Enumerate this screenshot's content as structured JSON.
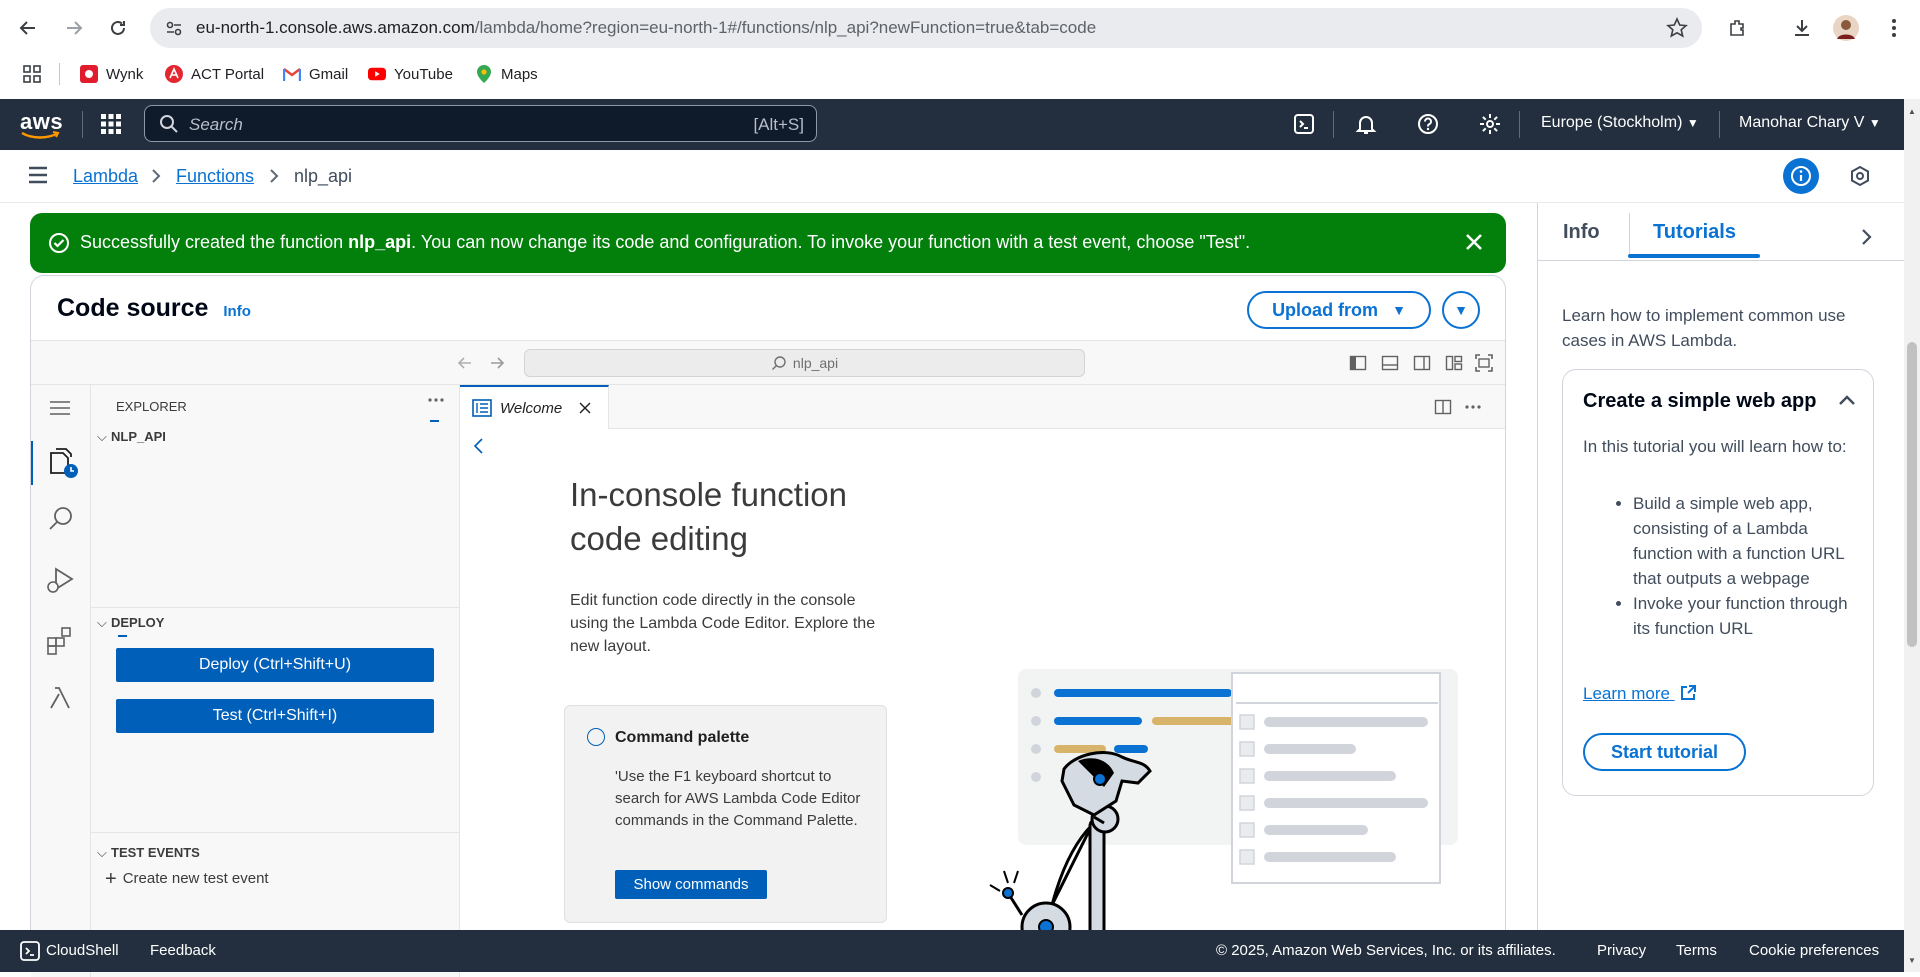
{
  "browser": {
    "url_host": "eu-north-1.console.aws.amazon.com",
    "url_path": "/lambda/home?region=eu-north-1#/functions/nlp_api?newFunction=true&tab=code",
    "bookmarks": [
      {
        "label": "Wynk"
      },
      {
        "label": "ACT Portal"
      },
      {
        "label": "Gmail"
      },
      {
        "label": "YouTube"
      },
      {
        "label": "Maps"
      }
    ]
  },
  "aws_header": {
    "logo": "aws",
    "search_placeholder": "Search",
    "search_shortcut": "[Alt+S]",
    "region": "Europe (Stockholm)",
    "user": "Manohar Chary V"
  },
  "breadcrumb": {
    "items": [
      "Lambda",
      "Functions"
    ],
    "current": "nlp_api"
  },
  "flash": {
    "prefix": "Successfully created the function ",
    "function_name": "nlp_api",
    "suffix": ". You can now change its code and configuration. To invoke your function with a test event, choose \"Test\"."
  },
  "code_source": {
    "title": "Code source",
    "info_label": "Info",
    "upload_label": "Upload from"
  },
  "editor": {
    "command_center": "nlp_api",
    "explorer_label": "EXPLORER",
    "folder_name": "NLP_API",
    "deploy_section": "DEPLOY",
    "deploy_button": "Deploy (Ctrl+Shift+U)",
    "test_button": "Test (Ctrl+Shift+I)",
    "test_events_section": "TEST EVENTS",
    "create_test_event": "Create new test event",
    "tab_label": "Welcome",
    "welcome_title_line1": "In-console function",
    "welcome_title_line2": "code editing",
    "welcome_desc": "Edit function code directly in the console using the Lambda Code Editor. Explore the new layout.",
    "command_palette_title": "Command palette",
    "command_palette_desc": "'Use the F1 keyboard shortcut to search for AWS Lambda Code Editor commands in the Command Palette.",
    "show_commands": "Show commands"
  },
  "right_panel": {
    "tabs": [
      "Info",
      "Tutorials"
    ],
    "active_tab": "Tutorials",
    "intro": "Learn how to implement common use cases in AWS Lambda.",
    "tutorial_title": "Create a simple web app",
    "tutorial_intro": "In this tutorial you will learn how to:",
    "bullets": [
      "Build a simple web app, consisting of a Lambda function with a function URL that outputs a webpage",
      "Invoke your function through its function URL"
    ],
    "learn_more": "Learn more",
    "start_tutorial": "Start tutorial"
  },
  "footer": {
    "cloudshell": "CloudShell",
    "feedback": "Feedback",
    "copyright": "© 2025, Amazon Web Services, Inc. or its affiliates.",
    "privacy": "Privacy",
    "terms": "Terms",
    "cookies": "Cookie preferences"
  },
  "colors": {
    "aws_nav": "#232f3e",
    "link_blue": "#0972d3",
    "success_green": "#037f0c",
    "editor_button": "#005fb8"
  }
}
